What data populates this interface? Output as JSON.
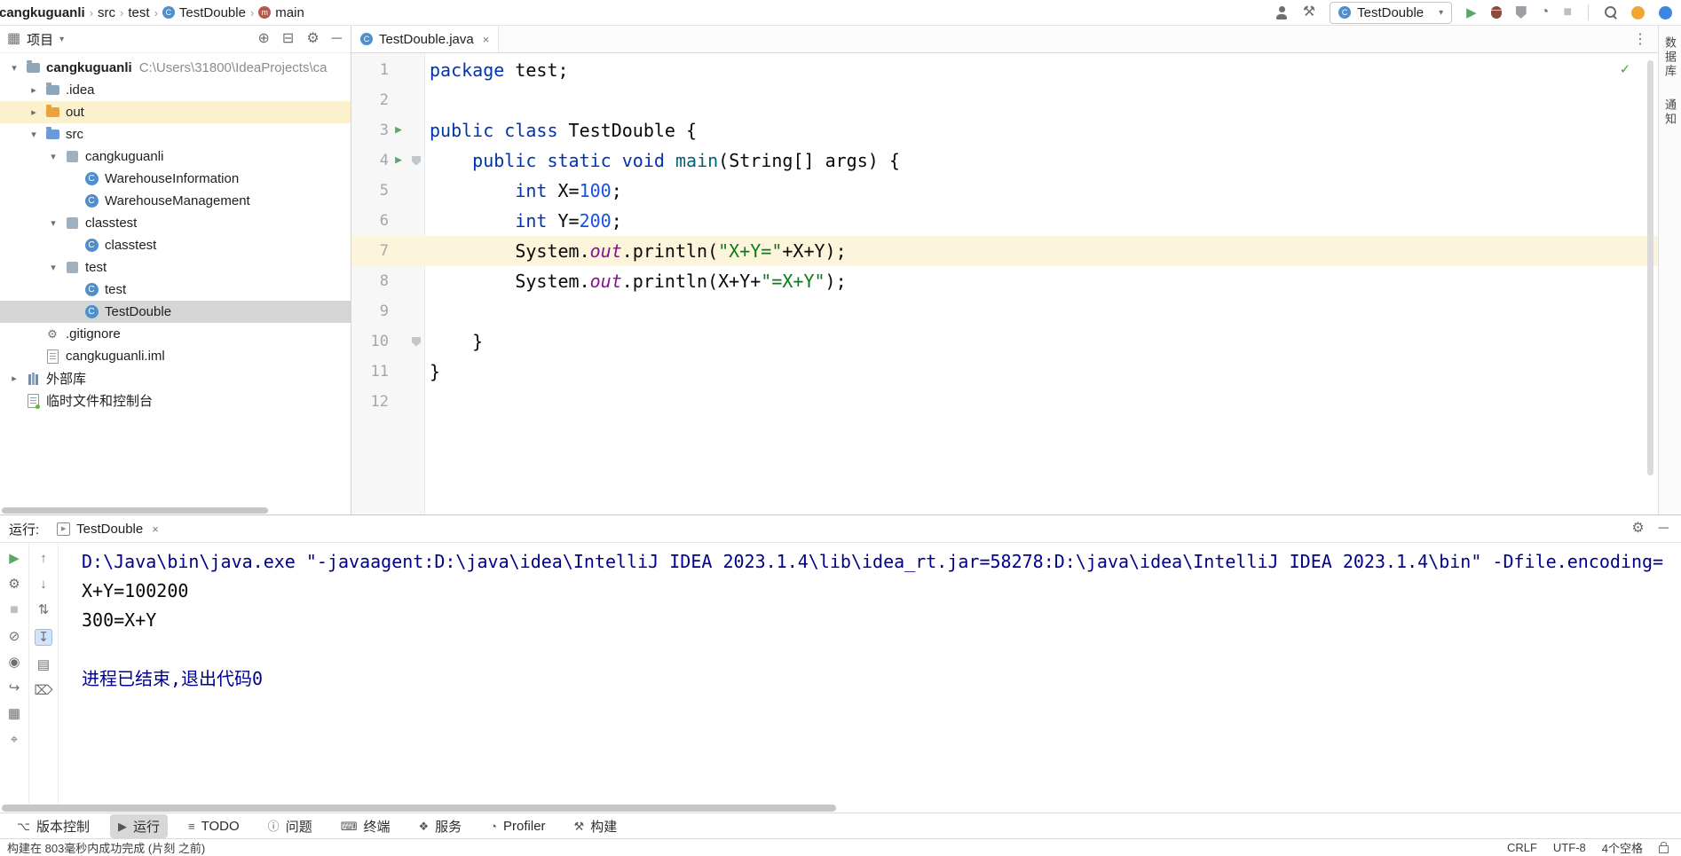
{
  "colors": {
    "keyword": "#0033B3",
    "string": "#067D17",
    "number": "#1750EB",
    "field": "#871094",
    "method": "#00627A",
    "system_output": "#00008B",
    "selection_gray": "#D5D5D5",
    "line_highlight": "#FCF5DC",
    "run_green": "#59A869"
  },
  "breadcrumbs": {
    "items": [
      {
        "label": "cangkuguanli",
        "bold": true
      },
      {
        "label": "src"
      },
      {
        "label": "test"
      },
      {
        "label": "TestDouble",
        "icon": "class"
      },
      {
        "label": "main",
        "icon": "method"
      }
    ]
  },
  "top_toolbar": {
    "left_icons": [
      "user",
      "hammer"
    ],
    "run_config": "TestDouble",
    "run_icons": [
      "play",
      "debug",
      "coverage",
      "profiler",
      "stop"
    ],
    "far_icons": [
      "search",
      "orange-circle",
      "blue-circle"
    ]
  },
  "project_panel": {
    "title": "项目",
    "header_icons": [
      "locate",
      "collapse-all",
      "settings",
      "hide"
    ],
    "tree": [
      {
        "label": "cangkuguanli",
        "suffix": "C:\\Users\\31800\\IdeaProjects\\ca",
        "level": 0,
        "chevron": "open",
        "icon": "folder",
        "bold": true
      },
      {
        "label": ".idea",
        "level": 1,
        "chevron": "closed",
        "icon": "folder"
      },
      {
        "label": "out",
        "level": 1,
        "chevron": "closed",
        "icon": "folder-excluded",
        "highlight": true
      },
      {
        "label": "src",
        "level": 1,
        "chevron": "open",
        "icon": "folder-src"
      },
      {
        "label": "cangkuguanli",
        "level": 2,
        "chevron": "open",
        "icon": "package"
      },
      {
        "label": "WarehouseInformation",
        "level": 3,
        "chevron": "none",
        "icon": "class"
      },
      {
        "label": "WarehouseManagement",
        "level": 3,
        "chevron": "none",
        "icon": "class"
      },
      {
        "label": "classtest",
        "level": 2,
        "chevron": "open",
        "icon": "package"
      },
      {
        "label": "classtest",
        "level": 3,
        "chevron": "none",
        "icon": "class"
      },
      {
        "label": "test",
        "level": 2,
        "chevron": "open",
        "icon": "package"
      },
      {
        "label": "test",
        "level": 3,
        "chevron": "none",
        "icon": "class"
      },
      {
        "label": "TestDouble",
        "level": 3,
        "chevron": "none",
        "icon": "class",
        "selected": true
      },
      {
        "label": ".gitignore",
        "level": 1,
        "chevron": "none",
        "icon": "gitfile"
      },
      {
        "label": "cangkuguanli.iml",
        "level": 1,
        "chevron": "none",
        "icon": "imlfile"
      },
      {
        "label": "外部库",
        "level": 0,
        "chevron": "closed",
        "icon": "library"
      },
      {
        "label": "临时文件和控制台",
        "level": 0,
        "chevron": "none",
        "icon": "scratch"
      }
    ]
  },
  "editor": {
    "tab": {
      "label": "TestDouble.java"
    },
    "lines": [
      {
        "n": 1,
        "seg": [
          [
            "k",
            "package"
          ],
          [
            "p",
            " test;"
          ]
        ]
      },
      {
        "n": 2,
        "seg": []
      },
      {
        "n": 3,
        "run": true,
        "seg": [
          [
            "k",
            "public"
          ],
          [
            "p",
            " "
          ],
          [
            "k",
            "class"
          ],
          [
            "p",
            " TestDouble {"
          ]
        ]
      },
      {
        "n": 4,
        "run": true,
        "shield": true,
        "seg": [
          [
            "p",
            "    "
          ],
          [
            "k",
            "public"
          ],
          [
            "p",
            " "
          ],
          [
            "k",
            "static"
          ],
          [
            "p",
            " "
          ],
          [
            "k",
            "void"
          ],
          [
            "p",
            " "
          ],
          [
            "m",
            "main"
          ],
          [
            "p",
            "(String[] args) {"
          ]
        ]
      },
      {
        "n": 5,
        "seg": [
          [
            "p",
            "        "
          ],
          [
            "k",
            "int"
          ],
          [
            "p",
            " X="
          ],
          [
            "num",
            "100"
          ],
          [
            "p",
            ";"
          ]
        ]
      },
      {
        "n": 6,
        "seg": [
          [
            "p",
            "        "
          ],
          [
            "k",
            "int"
          ],
          [
            "p",
            " Y="
          ],
          [
            "num",
            "200"
          ],
          [
            "p",
            ";"
          ]
        ]
      },
      {
        "n": 7,
        "current": true,
        "seg": [
          [
            "p",
            "        System."
          ],
          [
            "f",
            "out"
          ],
          [
            "p",
            ".println("
          ],
          [
            "s",
            "\"X+Y=\""
          ],
          [
            "p",
            "+X+Y);"
          ]
        ]
      },
      {
        "n": 8,
        "seg": [
          [
            "p",
            "        System."
          ],
          [
            "f",
            "out"
          ],
          [
            "p",
            ".println(X+Y+"
          ],
          [
            "s",
            "\"=X+Y\""
          ],
          [
            "p",
            ");"
          ]
        ]
      },
      {
        "n": 9,
        "seg": []
      },
      {
        "n": 10,
        "shield": true,
        "seg": [
          [
            "p",
            "    }"
          ]
        ]
      },
      {
        "n": 11,
        "seg": [
          [
            "p",
            "}"
          ]
        ]
      },
      {
        "n": 12,
        "seg": []
      }
    ]
  },
  "right_stripe": {
    "items": [
      "数据库",
      "通知"
    ]
  },
  "run_panel": {
    "label": "运行:",
    "tab": "TestDouble",
    "header_icons": [
      "settings",
      "hide"
    ],
    "toolbar_col1": [
      "rerun",
      "wrench",
      "stop",
      "soft-stop",
      "camera",
      "exit",
      "layout",
      "pin"
    ],
    "toolbar_col2": [
      "up",
      "down",
      "swap",
      "scroll-end",
      "print",
      "clear"
    ],
    "console": [
      {
        "style": "system",
        "text": "D:\\Java\\bin\\java.exe \"-javaagent:D:\\java\\idea\\IntelliJ IDEA 2023.1.4\\lib\\idea_rt.jar=58278:D:\\java\\idea\\IntelliJ IDEA 2023.1.4\\bin\" -Dfile.encoding="
      },
      {
        "style": "normal",
        "text": "X+Y=100200"
      },
      {
        "style": "normal",
        "text": "300=X+Y"
      },
      {
        "style": "normal",
        "text": ""
      },
      {
        "style": "system",
        "text": "进程已结束,退出代码0"
      }
    ]
  },
  "toolwindow_bar": {
    "items": [
      {
        "label": "版本控制",
        "icon": "branch"
      },
      {
        "label": "运行",
        "icon": "play-small",
        "active": true
      },
      {
        "label": "TODO",
        "icon": "todo"
      },
      {
        "label": "问题",
        "icon": "problems"
      },
      {
        "label": "终端",
        "icon": "terminal"
      },
      {
        "label": "服务",
        "icon": "services"
      },
      {
        "label": "Profiler",
        "icon": "profiler-small"
      },
      {
        "label": "构建",
        "icon": "hammer-small"
      }
    ]
  },
  "status_bar": {
    "left": "构建在 803毫秒内成功完成 (片刻 之前)",
    "right": [
      "CRLF",
      "UTF-8",
      "4个空格"
    ]
  }
}
